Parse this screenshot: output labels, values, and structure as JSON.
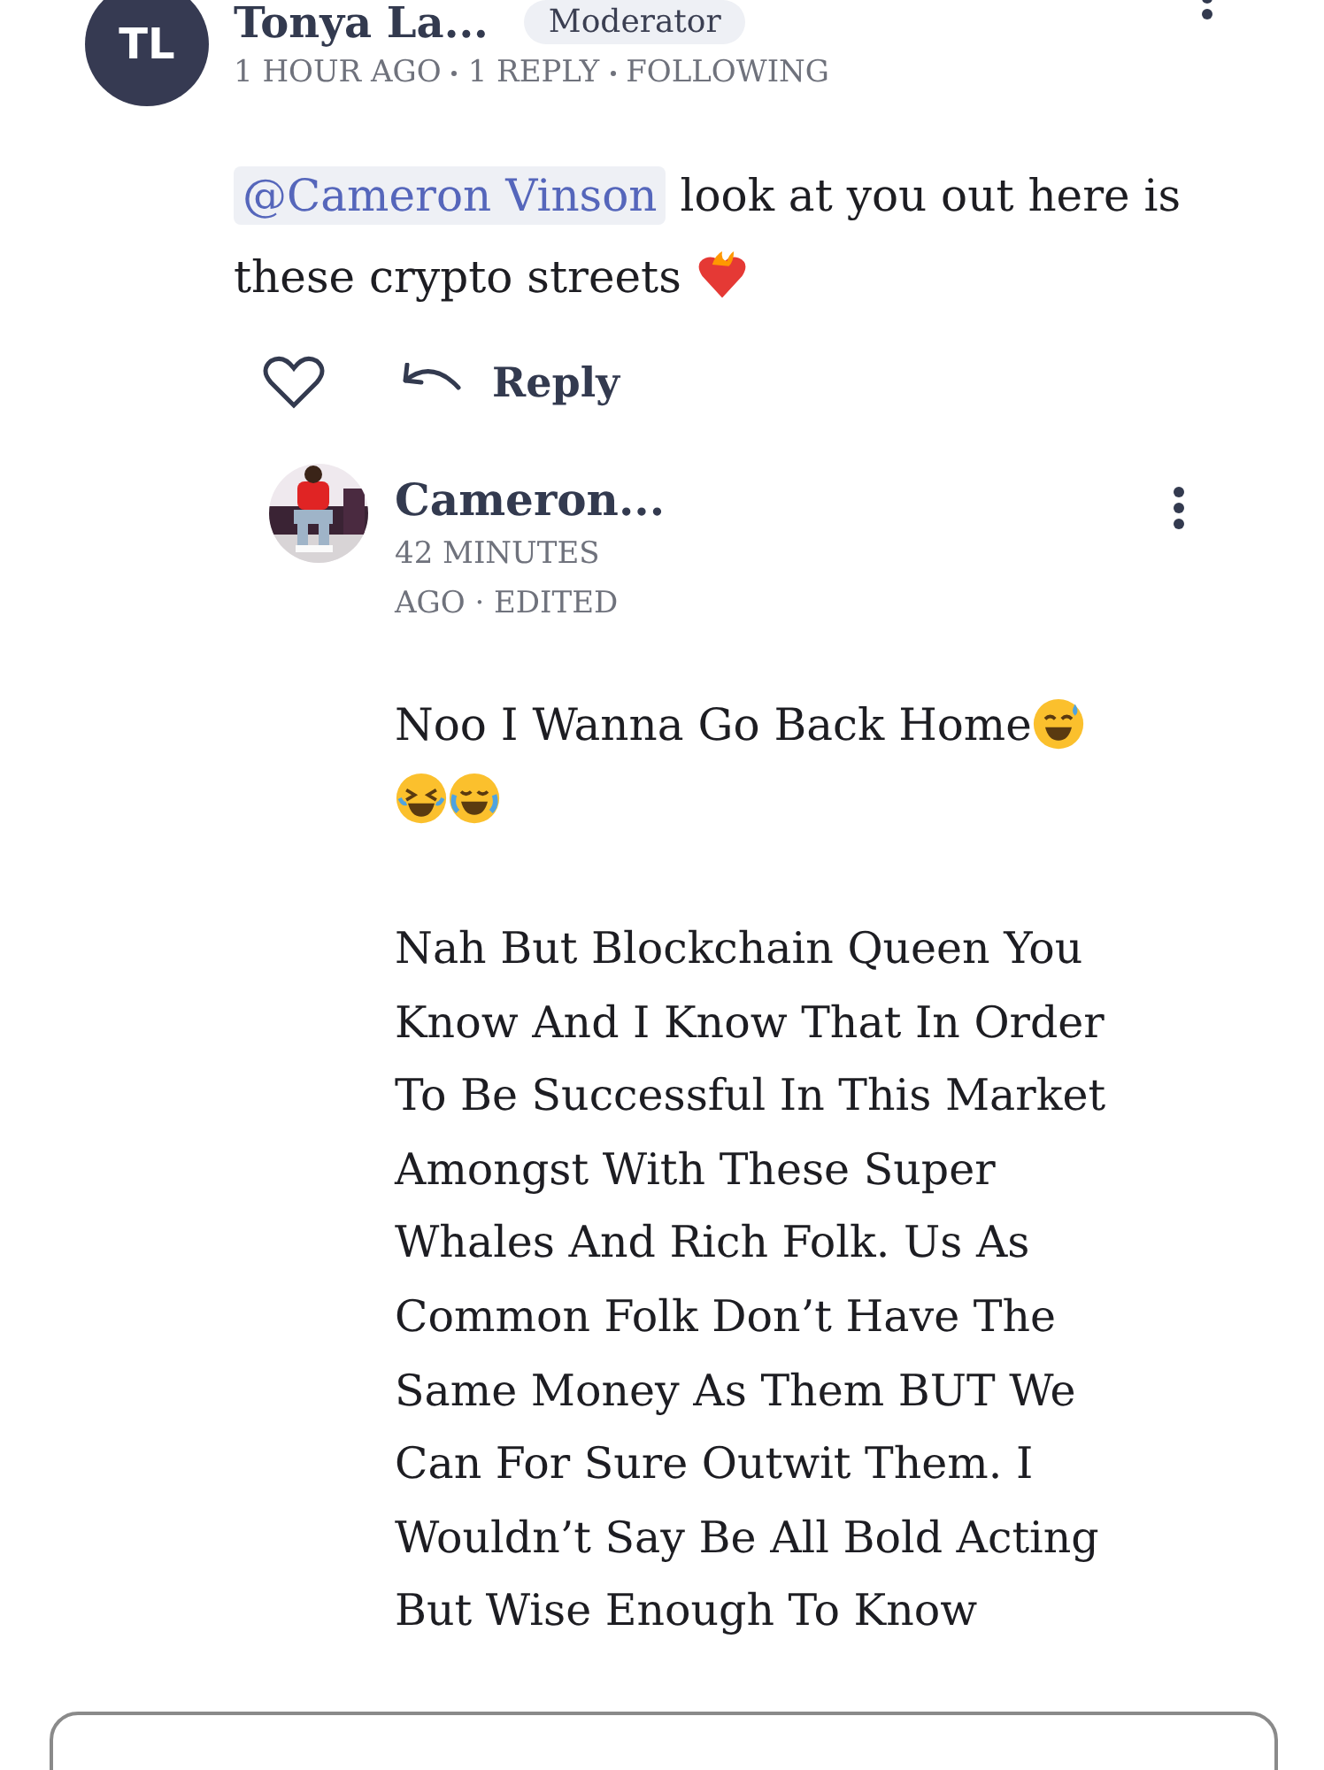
{
  "comment": {
    "avatar_initials": "TL",
    "author": "Tonya La...",
    "badge": "Moderator",
    "meta": [
      "1 HOUR AGO",
      "1 REPLY",
      "FOLLOWING"
    ],
    "mention": "@Cameron Vinson",
    "text": "look at you out here is these crypto streets",
    "liked": false,
    "reply_label": "Reply"
  },
  "reply": {
    "author": "Cameron...",
    "meta": "42 MINUTES AGO · EDITED",
    "first_line": "Noo I Wanna Go Back Home",
    "body_lines": [
      "Nah But Blockchain Queen You",
      "Know And I Know That In Order",
      "To Be Successful In This Market",
      "Amongst With These Super",
      "Whales And Rich Folk. Us As",
      "Common Folk Don’t Have The",
      "Same Money As Them BUT We",
      "Can For Sure Outwit Them. I",
      "Wouldn’t Say Be All Bold Acting",
      "But Wise Enough To Know"
    ]
  }
}
